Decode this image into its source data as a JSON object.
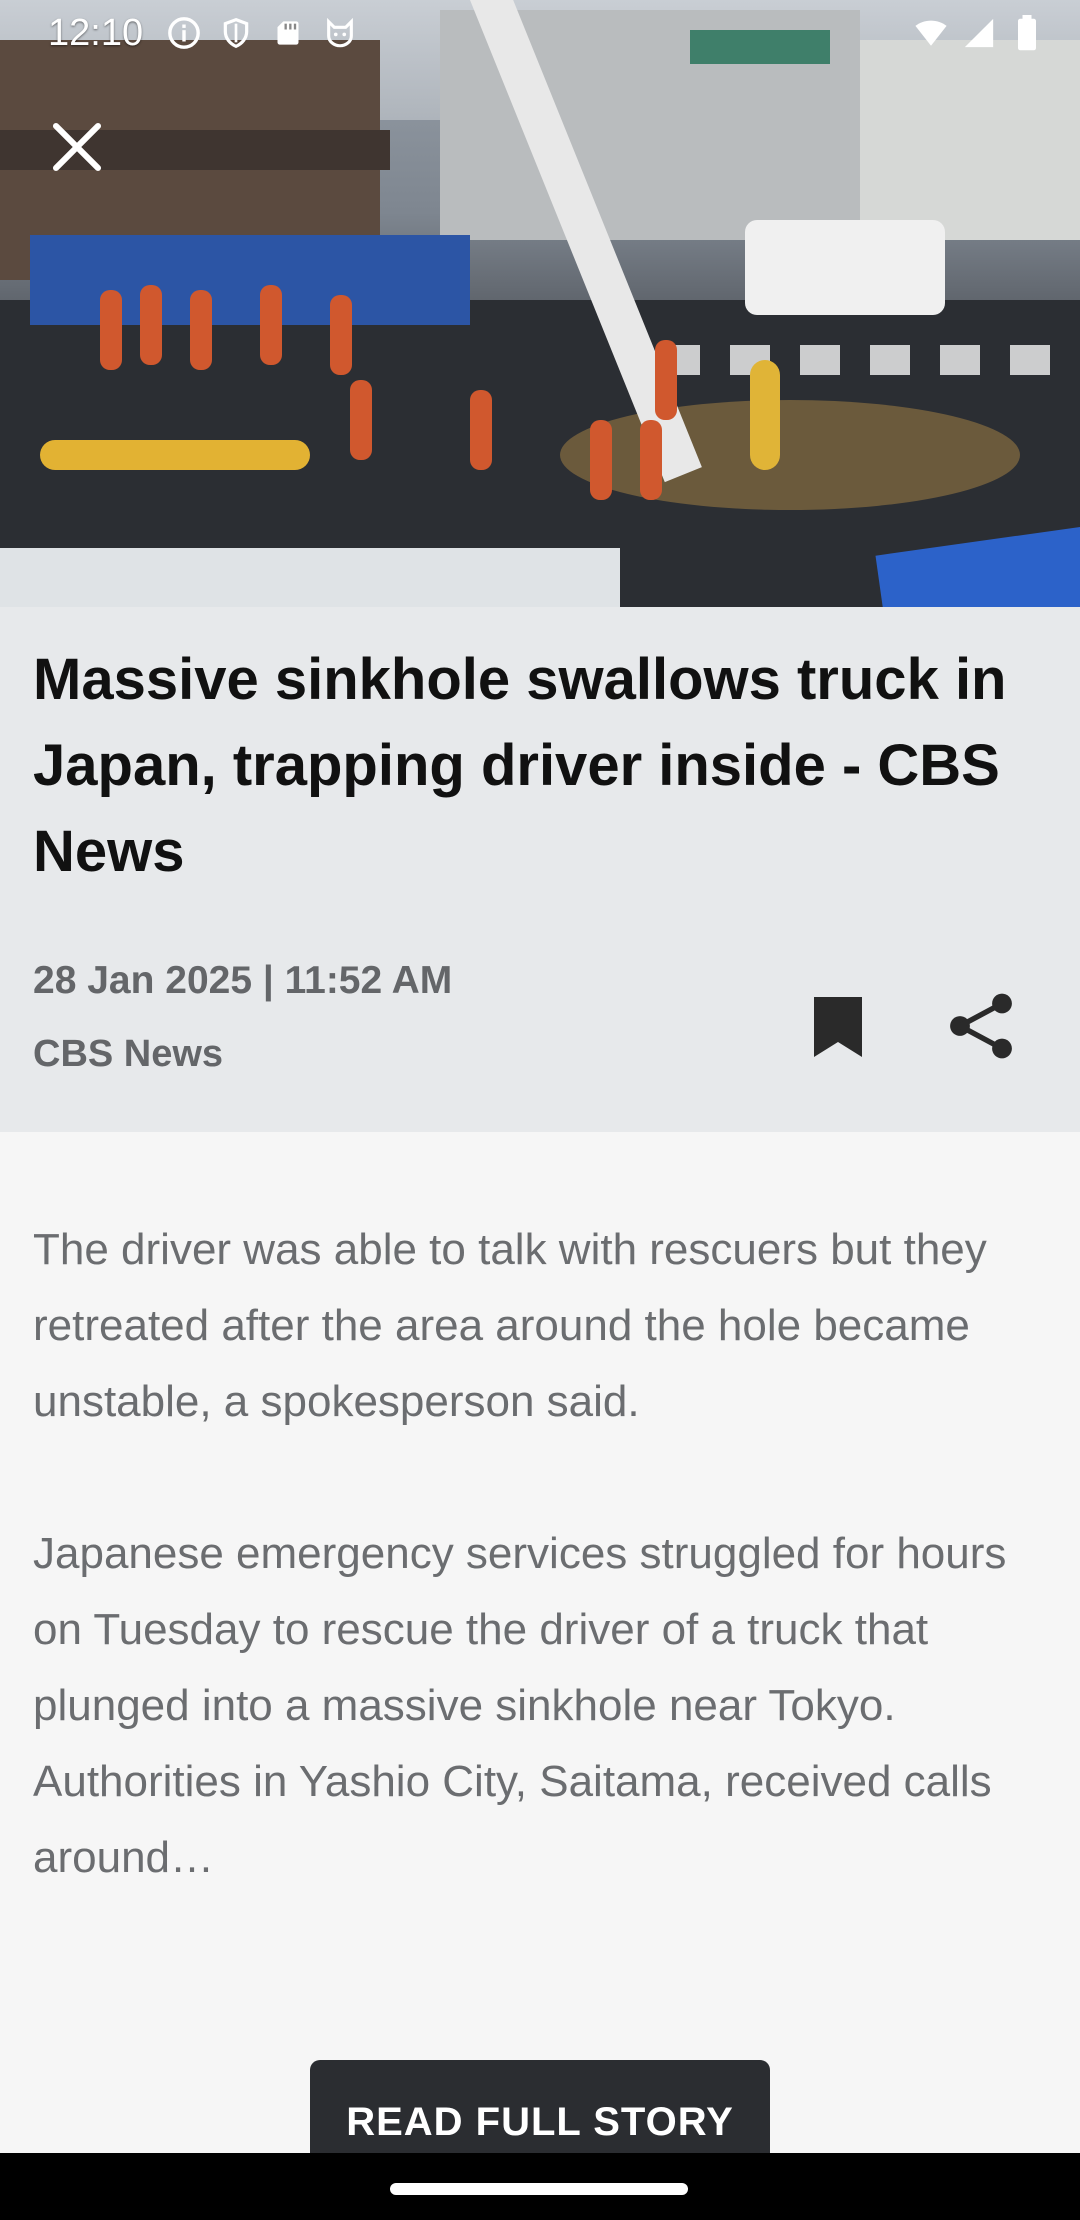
{
  "status_bar": {
    "time": "12:10",
    "left_icons": [
      "info-icon",
      "shield-icon",
      "sd-card-icon",
      "cat-icon"
    ],
    "right_icons": [
      "wifi-icon",
      "signal-icon",
      "battery-icon"
    ]
  },
  "hero": {
    "image": "photo of rescue workers around a sinkhole at a Japanese street intersection"
  },
  "article": {
    "title": "Massive sinkhole swallows truck in Japan, trapping driver inside - CBS News",
    "date": "28 Jan 2025 | 11:52 AM",
    "source": "CBS News",
    "paragraphs": [
      "The driver was able to talk with rescuers but they retreated after the area around the hole became unstable, a spokesperson said.",
      "Japanese emergency services struggled for hours on Tuesday to rescue the driver of a truck that plunged into a massive sinkhole near Tokyo.",
      "Authorities in Yashio City, Saitama, received calls around…"
    ]
  },
  "actions": {
    "close": "close-icon",
    "bookmark": "bookmark-icon",
    "share": "share-icon",
    "read_full_story": "READ FULL STORY"
  },
  "colors": {
    "header_bg": "#e7e9eb",
    "page_bg": "#f6f6f6",
    "button_bg": "#2b2d31",
    "meta_text": "#646669",
    "body_text": "#6b6d70"
  }
}
